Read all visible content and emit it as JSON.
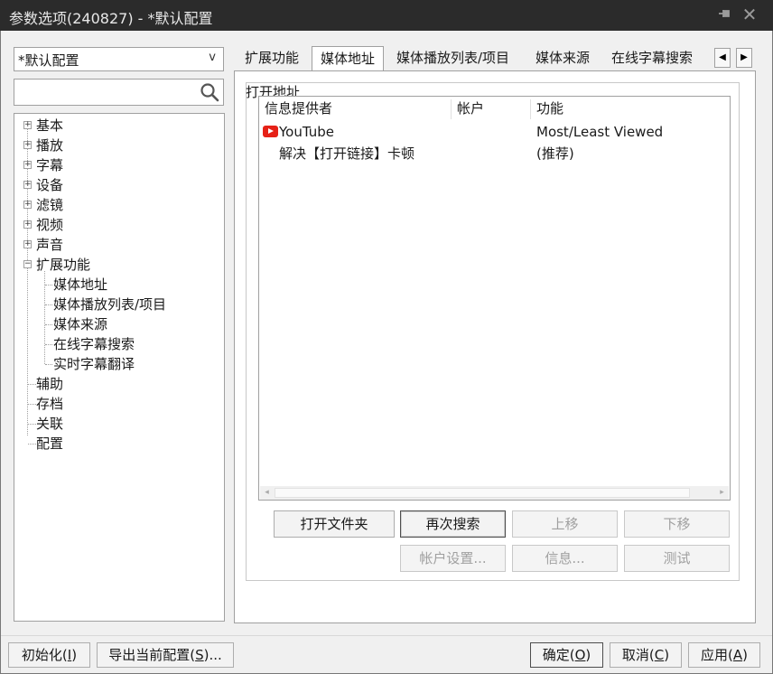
{
  "window": {
    "title": "参数选项(240827) - *默认配置",
    "pin_icon": "pin-icon",
    "close_icon": "close-icon",
    "close_glyph": "✕"
  },
  "left_panel": {
    "profile_select": {
      "value": "*默认配置",
      "chevron": "v"
    },
    "search": {
      "value": "",
      "placeholder": ""
    },
    "tree": [
      {
        "label": "基本",
        "expandable": true,
        "expanded": false
      },
      {
        "label": "播放",
        "expandable": true,
        "expanded": false
      },
      {
        "label": "字幕",
        "expandable": true,
        "expanded": false
      },
      {
        "label": "设备",
        "expandable": true,
        "expanded": false
      },
      {
        "label": "滤镜",
        "expandable": true,
        "expanded": false
      },
      {
        "label": "视频",
        "expandable": true,
        "expanded": false
      },
      {
        "label": "声音",
        "expandable": true,
        "expanded": false
      },
      {
        "label": "扩展功能",
        "expandable": true,
        "expanded": true,
        "children": [
          {
            "label": "媒体地址",
            "selected": true
          },
          {
            "label": "媒体播放列表/项目"
          },
          {
            "label": "媒体来源"
          },
          {
            "label": "在线字幕搜索"
          },
          {
            "label": "实时字幕翻译"
          }
        ]
      },
      {
        "label": "辅助"
      },
      {
        "label": "存档"
      },
      {
        "label": "关联"
      },
      {
        "label": "配置"
      }
    ],
    "expander_glyphs": {
      "collapsed": "+",
      "expanded": "−"
    }
  },
  "tabs": {
    "items": [
      {
        "label": "扩展功能",
        "active": false
      },
      {
        "label": "媒体地址",
        "active": true
      },
      {
        "label": "媒体播放列表/项目",
        "active": false
      },
      {
        "label": "媒体来源",
        "active": false
      },
      {
        "label": "在线字幕搜索",
        "active": false
      }
    ],
    "scroll_left": "◀",
    "scroll_right": "▶"
  },
  "content": {
    "group_title": "打开地址",
    "columns": [
      "信息提供者",
      "帐户",
      "功能"
    ],
    "rows": [
      {
        "provider": "YouTube",
        "icon": "youtube-icon",
        "account": "",
        "feature": "Most/Least Viewed"
      },
      {
        "provider": "解决【打开链接】卡顿",
        "icon": "",
        "account": "",
        "feature": "(推荐)"
      }
    ],
    "scroll_left": "◂",
    "scroll_right": "▸",
    "buttons_row1": [
      {
        "label": "打开文件夹",
        "enabled": true
      },
      {
        "label": "再次搜索",
        "enabled": true
      },
      {
        "label": "上移",
        "enabled": false
      },
      {
        "label": "下移",
        "enabled": false
      }
    ],
    "buttons_row2": [
      {
        "label": "帐户设置...",
        "enabled": false
      },
      {
        "label": "信息...",
        "enabled": false
      },
      {
        "label": "测试",
        "enabled": false
      }
    ]
  },
  "footer": {
    "init": {
      "label": "初始化(I)",
      "text": "初始化(",
      "key": "I",
      "tail": ")"
    },
    "export": {
      "label": "导出当前配置(S)...",
      "text": "导出当前配置(",
      "key": "S",
      "tail": ")..."
    },
    "ok": {
      "label": "确定(O)",
      "text": "确定(",
      "key": "O",
      "tail": ")"
    },
    "cancel": {
      "label": "取消(C)",
      "text": "取消(",
      "key": "C",
      "tail": ")"
    },
    "apply": {
      "label": "应用(A)",
      "text": "应用(",
      "key": "A",
      "tail": ")"
    }
  }
}
